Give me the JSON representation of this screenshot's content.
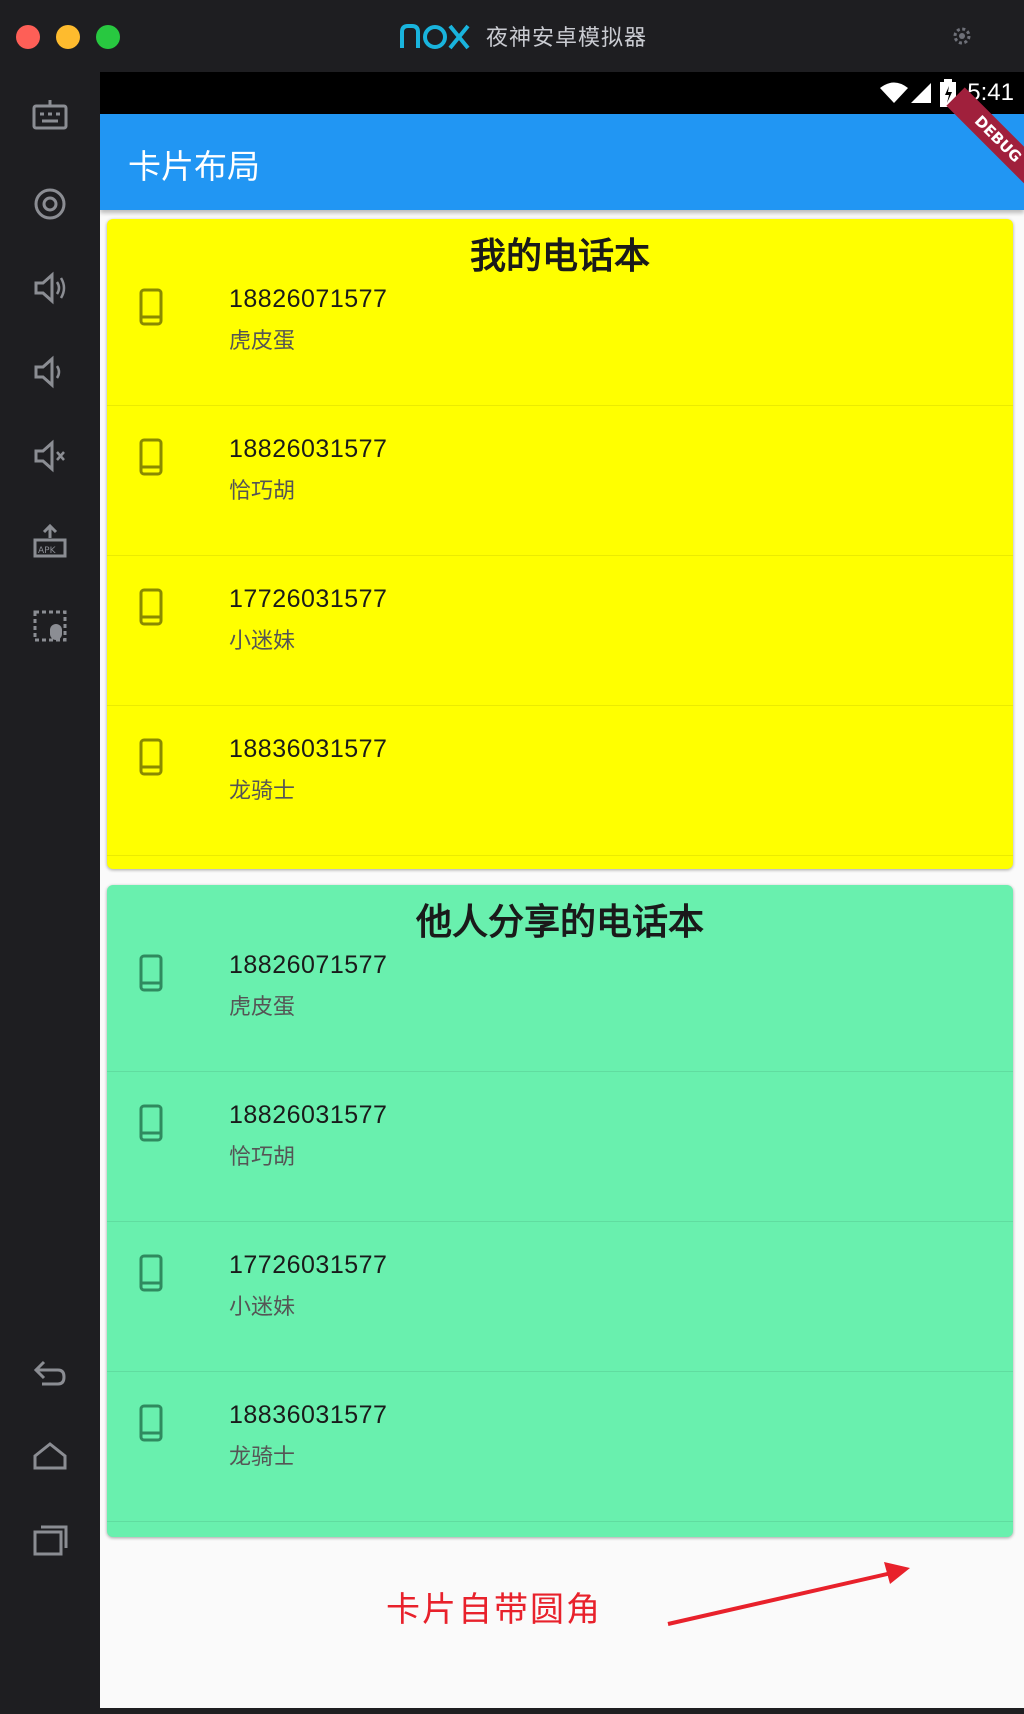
{
  "window": {
    "brand_name": "nox",
    "title": "夜神安卓模拟器"
  },
  "status_bar": {
    "time": "5:41"
  },
  "app_bar": {
    "title": "卡片布局",
    "debug_banner": "DEBUG"
  },
  "cards": [
    {
      "title": "我的电话本",
      "background": "#ffff00",
      "contacts": [
        {
          "number": "18826071577",
          "name": "虎皮蛋"
        },
        {
          "number": "18826031577",
          "name": "恰巧胡"
        },
        {
          "number": "17726031577",
          "name": "小迷妹"
        },
        {
          "number": "18836031577",
          "name": "龙骑士"
        }
      ]
    },
    {
      "title": "他人分享的电话本",
      "background": "#69f0ae",
      "contacts": [
        {
          "number": "18826071577",
          "name": "虎皮蛋"
        },
        {
          "number": "18826031577",
          "name": "恰巧胡"
        },
        {
          "number": "17726031577",
          "name": "小迷妹"
        },
        {
          "number": "18836031577",
          "name": "龙骑士"
        }
      ]
    }
  ],
  "annotation": {
    "text": "卡片自带圆角",
    "color": "#e8212b"
  },
  "colors": {
    "app_bar": "#2196f3",
    "emulator_frame": "#1e1e21",
    "phone_icon_card_1": "#8a8a00",
    "phone_icon_card_2": "#2f8a5f"
  },
  "toolbar_icons": [
    "keyboard-icon",
    "location-icon",
    "volume-up-icon",
    "volume-down-icon",
    "mute-icon",
    "apk-install-icon",
    "multi-touch-icon",
    "back-icon",
    "home-icon",
    "recent-apps-icon"
  ]
}
